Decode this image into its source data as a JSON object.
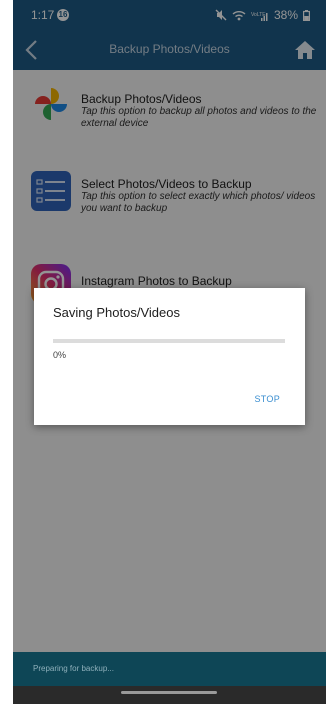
{
  "status_bar": {
    "time": "1:17",
    "notification_count": "16",
    "battery": "38%"
  },
  "app_bar": {
    "title": "Backup Photos/Videos"
  },
  "menu": {
    "items": [
      {
        "title": "Backup Photos/Videos",
        "description": "Tap this option to backup all photos and videos to the external device",
        "icon": "pinwheel-photos-icon"
      },
      {
        "title": "Select Photos/Videos to Backup",
        "description": "Tap this option to select exactly which photos/ videos you want to backup",
        "icon": "checklist-icon"
      },
      {
        "title": "Instagram Photos to Backup",
        "description": "",
        "icon": "instagram-icon"
      }
    ]
  },
  "dialog": {
    "title": "Saving Photos/Videos",
    "progress": 0,
    "progress_text": "0%",
    "stop_label": "STOP"
  },
  "bottom_bar": {
    "status": "Preparing for backup..."
  },
  "colors": {
    "primary": "#1e5b86",
    "accent": "#3a8ed0",
    "bottom_bar": "#0e4656"
  }
}
